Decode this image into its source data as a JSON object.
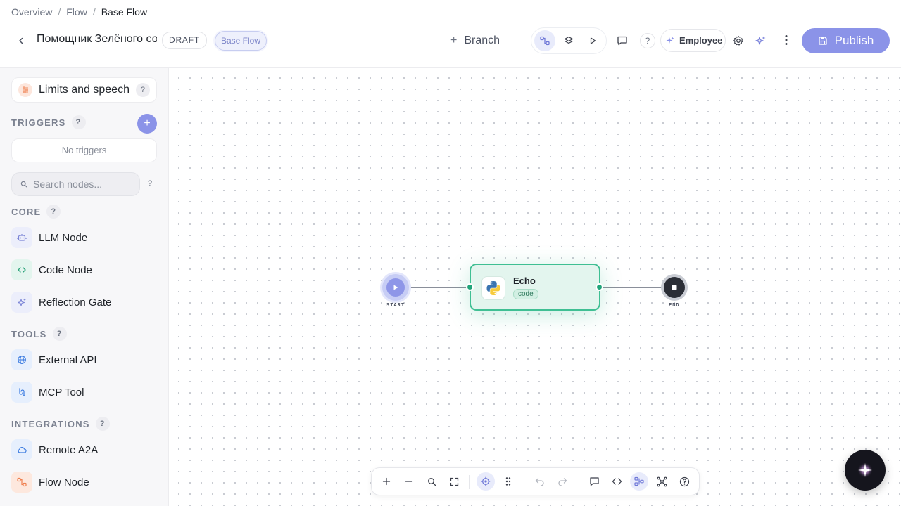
{
  "breadcrumb": {
    "items": [
      "Overview",
      "Flow"
    ],
    "current": "Base Flow"
  },
  "header": {
    "agent_name": "Помощник Зелёного со",
    "status": "DRAFT",
    "flow_badge": "Base Flow",
    "branch_label": "Branch",
    "help": "?",
    "employee_label": "Employee",
    "publish_label": "Publish"
  },
  "sidebar": {
    "limits_label": "Limits and speech",
    "triggers_title": "TRIGGERS",
    "add_trigger": "+",
    "no_triggers": "No triggers",
    "search_placeholder": "Search nodes...",
    "help": "?",
    "core": {
      "title": "CORE",
      "items": [
        "LLM Node",
        "Code Node",
        "Reflection Gate"
      ]
    },
    "tools": {
      "title": "TOOLS",
      "items": [
        "External API",
        "MCP Tool"
      ]
    },
    "integrations": {
      "title": "INTEGRATIONS",
      "items": [
        "Remote A2A",
        "Flow Node"
      ]
    }
  },
  "canvas": {
    "start_label": "START",
    "end_label": "END",
    "echo_node": {
      "title": "Echo",
      "tag": "code"
    }
  },
  "colors": {
    "accent": "#8b93e8",
    "node_green": "#3fbf93",
    "handle_green": "#21a57a"
  },
  "icons": {
    "header": [
      "chevron-left-icon",
      "flow-graph-icon",
      "layers-icon",
      "play-icon",
      "comment-icon",
      "sparkle-icon",
      "gear-icon",
      "magic-icon",
      "more-vertical-icon",
      "save-icon"
    ],
    "bottom_toolbar": [
      "zoom-in-icon",
      "zoom-out-icon",
      "search-icon",
      "fit-view-icon",
      "focus-icon",
      "drag-grid-icon",
      "undo-icon",
      "redo-icon",
      "comment-icon",
      "code-icon",
      "layout-icon",
      "network-icon",
      "help-icon"
    ]
  }
}
